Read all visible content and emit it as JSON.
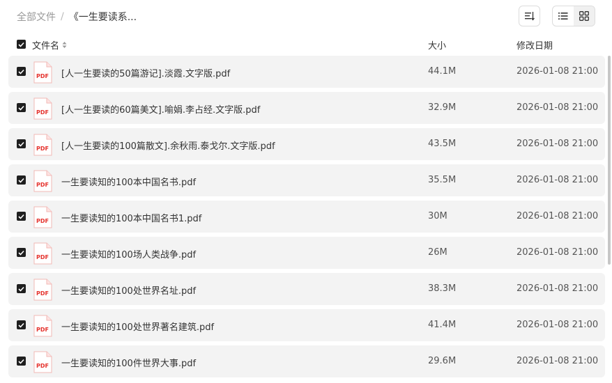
{
  "breadcrumb": {
    "root": "全部文件",
    "separator": "/",
    "current": "《一生要读系..."
  },
  "toolbar": {
    "sort_icon": "sort-icon",
    "list_icon": "list-view-icon",
    "grid_icon": "grid-view-icon"
  },
  "table": {
    "columns": {
      "name": "文件名",
      "size": "大小",
      "date": "修改日期"
    },
    "file_icon_label": "PDF",
    "rows": [
      {
        "name": "[人一生要读的50篇游记].淡霞.文字版.pdf",
        "size": "44.1M",
        "date": "2026-01-08 21:00"
      },
      {
        "name": "[人一生要读的60篇美文].喻娟.李占经.文字版.pdf",
        "size": "32.9M",
        "date": "2026-01-08 21:00"
      },
      {
        "name": "[人一生要读的100篇散文].余秋雨.泰戈尔.文字版.pdf",
        "size": "43.5M",
        "date": "2026-01-08 21:00"
      },
      {
        "name": "一生要读知的100本中国名书.pdf",
        "size": "35.5M",
        "date": "2026-01-08 21:00"
      },
      {
        "name": "一生要读知的100本中国名书1.pdf",
        "size": "30M",
        "date": "2026-01-08 21:00"
      },
      {
        "name": "一生要读知的100场人类战争.pdf",
        "size": "26M",
        "date": "2026-01-08 21:00"
      },
      {
        "name": "一生要读知的100处世界名址.pdf",
        "size": "38.3M",
        "date": "2026-01-08 21:00"
      },
      {
        "name": "一生要读知的100处世界著名建筑.pdf",
        "size": "41.4M",
        "date": "2026-01-08 21:00"
      },
      {
        "name": "一生要读知的100件世界大事.pdf",
        "size": "29.6M",
        "date": "2026-01-08 21:00"
      }
    ]
  },
  "colors": {
    "row_bg": "#f3f3f3",
    "checkbox": "#1f1f1f",
    "pdf_red": "#e5322d"
  }
}
